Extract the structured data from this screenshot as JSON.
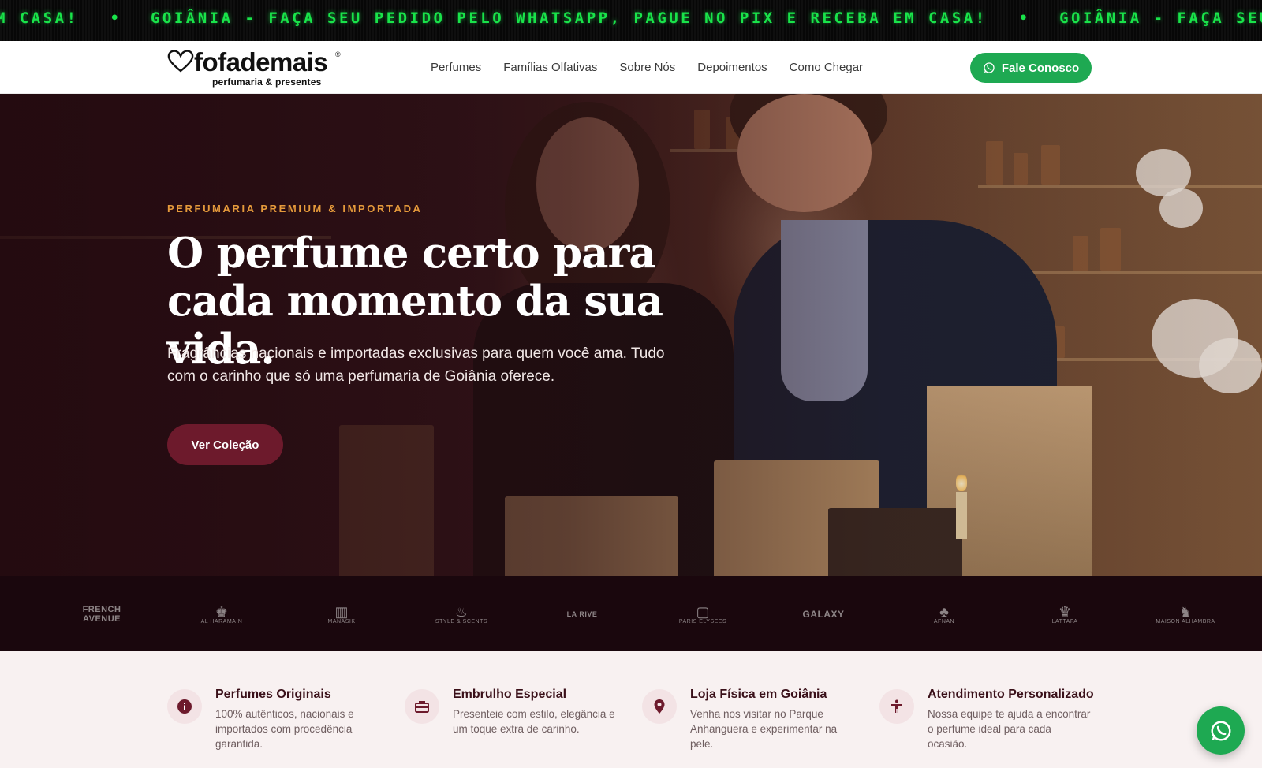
{
  "ticker": {
    "items": [
      "EM CASA!",
      "GOIÂNIA - FAÇA SEU PEDIDO PELO WHATSAPP, PAGUE NO PIX E RECEBA EM CASA!",
      "GOIÂNIA - FAÇA SEU PEDIDO PELO"
    ],
    "separator": "•",
    "color": "#19e34a"
  },
  "header": {
    "logo": {
      "wordmark": "fofademais",
      "registered": "®",
      "tagline": "perfumaria & presentes",
      "icon": "heart-icon"
    },
    "nav": [
      "Perfumes",
      "Famílias Olfativas",
      "Sobre Nós",
      "Depoimentos",
      "Como Chegar"
    ],
    "cta": {
      "label": "Fale Conosco",
      "icon": "whatsapp-icon",
      "color": "#1ea952"
    }
  },
  "hero": {
    "kicker": "PERFUMARIA PREMIUM & IMPORTADA",
    "headline": "O perfume certo para cada momento da sua vida.",
    "subtext": "Fragrâncias nacionais e importadas exclusivas para quem você ama. Tudo com o carinho que só uma perfumaria de Goiânia oferece.",
    "button": "Ver Coleção",
    "accent": "#e59a3b",
    "button_color": "#6d1a2c"
  },
  "brands": [
    {
      "name": "FRENCH AVENUE",
      "mark": ""
    },
    {
      "name": "AL HARAMAIN",
      "mark": "♚"
    },
    {
      "name": "MANASIK",
      "mark": "▥"
    },
    {
      "name": "STYLE & SCENTS",
      "mark": "♨"
    },
    {
      "name": "LA RIVE",
      "mark": ""
    },
    {
      "name": "PARIS ELYSEES",
      "mark": "▢"
    },
    {
      "name": "GALAXY",
      "mark": ""
    },
    {
      "name": "AFNAN",
      "mark": "♣"
    },
    {
      "name": "LATTAFA",
      "mark": "♛"
    },
    {
      "name": "MAISON ALHAMBRA",
      "mark": "♞"
    }
  ],
  "features": [
    {
      "icon": "info-icon",
      "title": "Perfumes Originais",
      "desc": "100% autênticos, nacionais e importados com procedência garantida."
    },
    {
      "icon": "gift-box-icon",
      "title": "Embrulho Especial",
      "desc": "Presenteie com estilo, elegância e um toque extra de carinho."
    },
    {
      "icon": "location-pin-icon",
      "title": "Loja Física em Goiânia",
      "desc": "Venha nos visitar no Parque Anhanguera e experimentar na pele."
    },
    {
      "icon": "person-icon",
      "title": "Atendimento Personalizado",
      "desc": "Nossa equipe te ajuda a encontrar o perfume ideal para cada ocasião."
    }
  ],
  "floating": {
    "icon": "whatsapp-icon"
  }
}
